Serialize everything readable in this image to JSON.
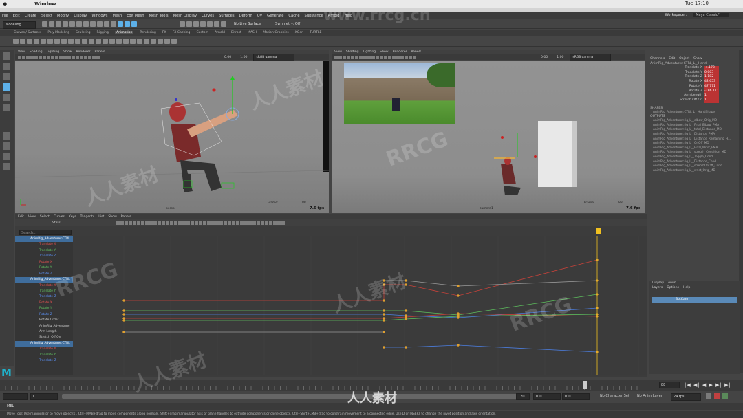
{
  "mac": {
    "app": "Window",
    "clock": "Tue 17:10"
  },
  "menus": [
    "File",
    "Edit",
    "Create",
    "Select",
    "Modify",
    "Display",
    "Windows",
    "Mesh",
    "Edit Mesh",
    "Mesh Tools",
    "Mesh Display",
    "Curves",
    "Surfaces",
    "Deform",
    "UV",
    "Generate",
    "Cache",
    "Substance",
    "Arnold",
    "Help"
  ],
  "workspace": {
    "label": "Workspace :",
    "value": "Maya Classic*"
  },
  "status": {
    "mode": "Modeling",
    "live": "No Live Surface",
    "symmetry": "Symmetry: Off"
  },
  "shelf_tabs": [
    "Curves / Surfaces",
    "Poly Modeling",
    "Sculpting",
    "Rigging",
    "Animation",
    "Rendering",
    "FX",
    "FX Caching",
    "Custom",
    "Arnold",
    "Bifrost",
    "MASH",
    "Motion Graphics",
    "XGen",
    "TURTLE"
  ],
  "shelf_active": "Animation",
  "viewport_menu": [
    "View",
    "Shading",
    "Lighting",
    "Show",
    "Renderer",
    "Panels"
  ],
  "viewport_vals": {
    "a": "0.00",
    "b": "1.00",
    "gamma": "sRGB gamma"
  },
  "left_view": {
    "camera": "persp",
    "frame_label": "Frame:",
    "frame": "88",
    "fps": "7.6 fps"
  },
  "right_view": {
    "camera": "camera1",
    "frame_label": "Frame:",
    "frame": "88",
    "fps": "7.6 fps"
  },
  "channel_menu": [
    "Channels",
    "Edit",
    "Object",
    "Show"
  ],
  "channel_node": "AnimRig_Adventurer:CTRL_L__Hand",
  "channels": [
    {
      "name": "Translate X",
      "value": "-4.178"
    },
    {
      "name": "Translate Y",
      "value": "0.003"
    },
    {
      "name": "Translate Z",
      "value": "1.182"
    },
    {
      "name": "Rotate X",
      "value": "42.653"
    },
    {
      "name": "Rotate Y",
      "value": "47.771"
    },
    {
      "name": "Rotate Z",
      "value": "-286.111"
    },
    {
      "name": "Arm Length",
      "value": "1"
    },
    {
      "name": "Stretch Off On",
      "value": "1"
    }
  ],
  "shapes_title": "SHAPES",
  "shape_item": "AnimRig_Adventurer:CTRL_L__HandShape",
  "outputs_title": "OUTPUTS",
  "outputs": [
    "AnimRig_Adventurer:rig_L__elbow_Orig_MD",
    "AnimRig_Adventurer:rig_L__Final_Elbow_PMA",
    "AnimRig_Adventurer:rig_L__total_Distance_MD",
    "AnimRig_Adventurer:rig_L__Distance_PMA",
    "AnimRig_Adventurer:rig_L__Distance_Remaining_H...",
    "AnimRig_Adventurer:rig_L__OnOff_MD",
    "AnimRig_Adventurer:rig_L__Final_Wrist_PMA",
    "AnimRig_Adventurer:rig_L__stretch_Condition_MD",
    "AnimRig_Adventurer:rig_L__Toggle_Cond",
    "AnimRig_Adventurer:rig_L__Distance_Cond",
    "AnimRig_Adventurer:rig_L__stretchOnOff_Cond",
    "AnimRig_Adventurer:rig_L__wrist_Orig_MD"
  ],
  "graph_menu": [
    "Edit",
    "View",
    "Select",
    "Curves",
    "Keys",
    "Tangents",
    "List",
    "Show",
    "Panels"
  ],
  "graph_stats": "Stats",
  "search_placeholder": "Search...",
  "outliner": [
    {
      "label": "AnimRig_Adventurer:CTRL",
      "head": true,
      "color": "#ffffff"
    },
    {
      "label": "Translate X",
      "head": false,
      "color": "#e05050"
    },
    {
      "label": "Translate Y",
      "head": false,
      "color": "#60c060"
    },
    {
      "label": "Translate Z",
      "head": false,
      "color": "#5a8ef0"
    },
    {
      "label": "Rotate X",
      "head": false,
      "color": "#e05050"
    },
    {
      "label": "Rotate Y",
      "head": false,
      "color": "#60c060"
    },
    {
      "label": "Rotate Z",
      "head": false,
      "color": "#5a8ef0"
    },
    {
      "label": "AnimRig_Adventurer:CTRL",
      "head": true,
      "color": "#ffffff"
    },
    {
      "label": "Translate X",
      "head": false,
      "color": "#e05050"
    },
    {
      "label": "Translate Y",
      "head": false,
      "color": "#60c060"
    },
    {
      "label": "Translate Z",
      "head": false,
      "color": "#5a8ef0"
    },
    {
      "label": "Rotate X",
      "head": false,
      "color": "#e05050"
    },
    {
      "label": "Rotate Y",
      "head": false,
      "color": "#60c060"
    },
    {
      "label": "Rotate Z",
      "head": false,
      "color": "#5a8ef0"
    },
    {
      "label": "Rotate Order",
      "head": false,
      "color": "#cccccc"
    },
    {
      "label": "AnimRig_Adventurer",
      "head": false,
      "color": "#cccccc"
    },
    {
      "label": "Arm Length",
      "head": false,
      "color": "#cccccc"
    },
    {
      "label": "Stretch Off On",
      "head": false,
      "color": "#cccccc"
    },
    {
      "label": "AnimRig_Adventurer:CTRL",
      "head": true,
      "color": "#ffffff"
    },
    {
      "label": "Translate X",
      "head": false,
      "color": "#e05050"
    },
    {
      "label": "Translate Y",
      "head": false,
      "color": "#60c060"
    },
    {
      "label": "Translate Z",
      "head": false,
      "color": "#5a8ef0"
    }
  ],
  "layer_tabs": [
    "Display",
    "Anim"
  ],
  "layer_menu": [
    "Layers",
    "Options",
    "Help"
  ],
  "layer_name": "BotCam",
  "time": {
    "current": "88",
    "start": "1",
    "start2": "1",
    "end": "120",
    "end2": "100",
    "end3": "100",
    "fps": "24 fps",
    "range_left": "1",
    "range_right": "90"
  },
  "charset": "No Character Set",
  "animlayer": "No Anim Layer",
  "cmd_lang": "MEL",
  "help_text": "Move Tool: Use manipulator to move object(s). Ctrl+MMB+drag to move components along normals. Shift+drag manipulator axis or plane handles to extrude components or clone objects. Ctrl+Shift+LMB+drag to constrain movement to a connected edge. Use D or INSERT to change the pivot position and axis orientation.",
  "watermarks": [
    "www.rrcg.cn",
    "RRCG",
    "人人素材"
  ],
  "colors": {
    "accent": "#5db0e8",
    "curve_red": "#c8423a",
    "curve_green": "#5ec05e",
    "curve_blue": "#4c7ee0",
    "key": "#e0a030",
    "selected_row": "#3f6d9c"
  }
}
